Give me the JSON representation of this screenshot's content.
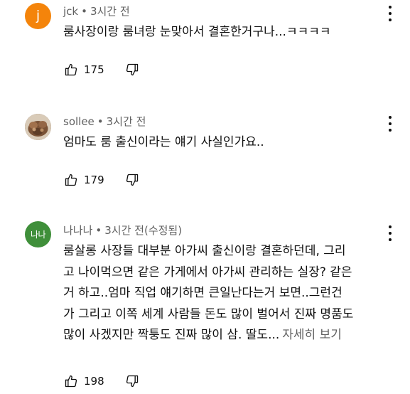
{
  "comments": [
    {
      "avatar": {
        "type": "letter",
        "text": "j",
        "color": "#f4840b"
      },
      "author": "jck",
      "separator": "•",
      "time": "3시간 전",
      "lines": [
        "룸사장이랑 룸녀랑 눈맞아서 결혼한거구나...ㅋㅋㅋㅋ"
      ],
      "likes": "175",
      "more_label": ""
    },
    {
      "avatar": {
        "type": "photo",
        "text": "",
        "color": "#6b4a32"
      },
      "author": "sollee",
      "separator": "•",
      "time": "3시간 전",
      "lines": [
        "엄마도 룸 출신이라는 얘기 사실인가요.."
      ],
      "likes": "179",
      "more_label": ""
    },
    {
      "avatar": {
        "type": "text",
        "text": "나나",
        "color": "#3f8f3a"
      },
      "author": "나나나",
      "separator": "•",
      "time": "3시간 전(수정됨)",
      "lines": [
        "룸살롱 사장들 대부분 아가씨 출신이랑 결혼하던데, 그리",
        "고 나이먹으면 같은 가게에서 아가씨 관리하는 실장? 같은",
        "거 하고..엄마 직업 얘기하면 큰일난다는거 보면..그런건",
        "가 그리고 이쪽 세계 사람들 돈도 많이 벌어서 진짜 명품도",
        "많이 사겠지만 짝퉁도 진짜 많이 삼. 딸도..."
      ],
      "likes": "198",
      "more_label": "자세히 보기"
    }
  ],
  "icons": {
    "like": "thumbs-up-icon",
    "dislike": "thumbs-down-icon",
    "menu": "more-vertical-icon"
  }
}
